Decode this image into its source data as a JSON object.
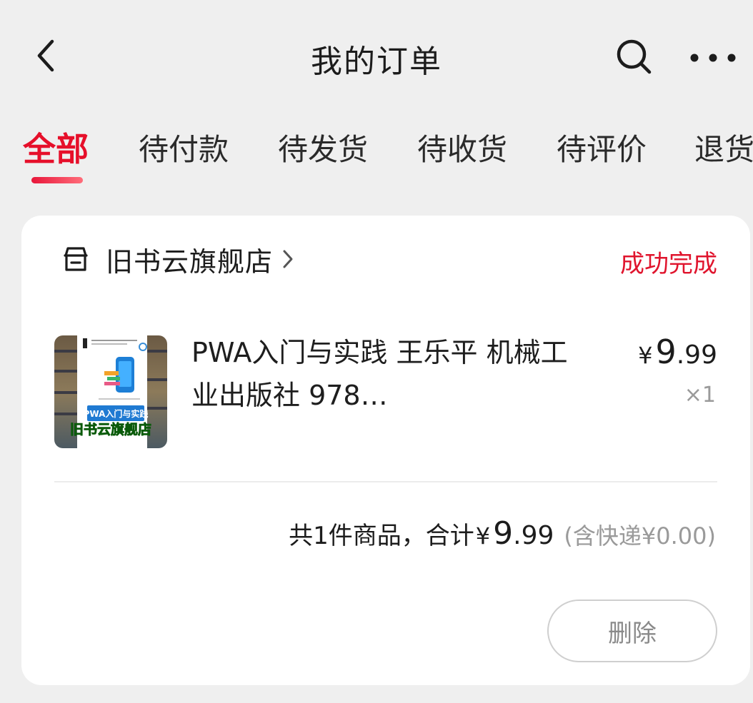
{
  "header": {
    "title": "我的订单",
    "back_icon": "chevron-left-icon",
    "search_icon": "search-icon",
    "more_icon": "more-horizontal-icon"
  },
  "tabs": [
    {
      "label": "全部",
      "active": true
    },
    {
      "label": "待付款",
      "active": false
    },
    {
      "label": "待发货",
      "active": false
    },
    {
      "label": "待收货",
      "active": false
    },
    {
      "label": "待评价",
      "active": false
    },
    {
      "label": "退货",
      "active": false
    }
  ],
  "order": {
    "store_name": "旧书云旗舰店",
    "status": "成功完成",
    "product": {
      "title": "PWA入门与实践 王乐平 机械工业出版社 978…",
      "price_symbol": "¥",
      "price_int": "9",
      "price_dec": ".99",
      "quantity": "×1",
      "thumb_cover_title": "PWA入门与实践",
      "thumb_watermark": "旧书云旗舰店"
    },
    "summary": {
      "label": "共1件商品，合计",
      "currency": "¥",
      "total_int": "9",
      "total_dec": ".99",
      "shipping": "(含快递¥0.00)"
    },
    "delete_label": "删除"
  },
  "colors": {
    "accent": "#e60f2a",
    "background": "#efefef",
    "card": "#ffffff",
    "muted": "#9a9a9a"
  }
}
